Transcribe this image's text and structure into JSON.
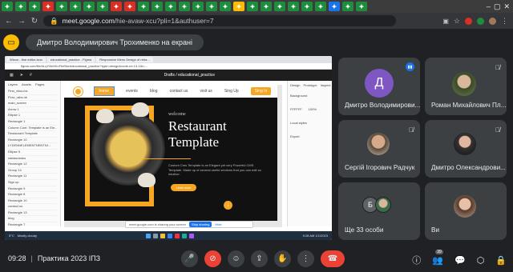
{
  "browser": {
    "url_host": "meet.google.com",
    "url_path": "/hie-avaw-xcu?pli=1&authuser=7",
    "tab_icons": [
      {
        "color": "#1e8e3e",
        "glyph": "✦"
      },
      {
        "color": "#1e8e3e",
        "glyph": "✦"
      },
      {
        "color": "#1e8e3e",
        "glyph": "✦"
      },
      {
        "color": "#d93025",
        "glyph": "✦"
      },
      {
        "color": "#1e8e3e",
        "glyph": "✦"
      },
      {
        "color": "#1e8e3e",
        "glyph": "✦"
      },
      {
        "color": "#1e8e3e",
        "glyph": "✦"
      },
      {
        "color": "#1e8e3e",
        "glyph": "✦"
      },
      {
        "color": "#d93025",
        "glyph": "✦"
      },
      {
        "color": "#d93025",
        "glyph": "✦"
      },
      {
        "color": "#1e8e3e",
        "glyph": "✦"
      },
      {
        "color": "#1e8e3e",
        "glyph": "✦"
      },
      {
        "color": "#1e8e3e",
        "glyph": "✦"
      },
      {
        "color": "#1e8e3e",
        "glyph": "✦"
      },
      {
        "color": "#1e8e3e",
        "glyph": "✦"
      },
      {
        "color": "#1e8e3e",
        "glyph": "✦"
      },
      {
        "color": "#1e8e3e",
        "glyph": "✦"
      },
      {
        "color": "#fbbc04",
        "glyph": "✦"
      },
      {
        "color": "#1e8e3e",
        "glyph": "✦"
      },
      {
        "color": "#1e8e3e",
        "glyph": "✦"
      },
      {
        "color": "#1e8e3e",
        "glyph": "✦"
      },
      {
        "color": "#1e8e3e",
        "glyph": "✦"
      },
      {
        "color": "#1e8e3e",
        "glyph": "✦"
      },
      {
        "color": "#1e8e3e",
        "glyph": "✦"
      },
      {
        "color": "#1a73e8",
        "glyph": "✦"
      },
      {
        "color": "#1e8e3e",
        "glyph": "✦"
      },
      {
        "color": "#1e8e3e",
        "glyph": "✦"
      }
    ]
  },
  "banner": {
    "presenting_text": "Дмитро Володимирович Трохименко на екрані"
  },
  "shared_screen": {
    "tabs": [
      "Wixon - fine editor-ixon",
      "educational_practice - Figma",
      "Responsive Menu Design of reha...",
      ""
    ],
    "url": "figma.com/file/hLqY0kMXoFfnf5kx/educational_practice?type=design&node-id=13-1&t=...",
    "top_bar": {
      "left": "Drafts",
      "project": "educational_practice"
    },
    "left_panel": {
      "tabs": [
        "Layers",
        "Assets",
        "Pages"
      ],
      "rows": [
        "First_vkus.ink",
        "Flow_rabs.nk",
        "main_screen",
        "Arrow 1",
        "Ellipse 1",
        "Rectangle 1",
        "Column Cont. Template is an Ele...",
        "Restaurant Template",
        "Rectangle 10",
        "LYDENNELEMENTNENTNI...",
        "Ellipse 5",
        "rastaurantus",
        "Rectangle 12",
        "Group 14",
        "Rectangle 11",
        "Sign up",
        "Rectangle 9",
        "Rectangle 8",
        "Rectangle 10",
        "contact us",
        "Rectangle 13",
        "blog",
        "Rectangle 7"
      ]
    },
    "right_panel": {
      "tabs": [
        "Design",
        "Prototype",
        "Inspect"
      ],
      "rows": [
        "Background",
        "FFFFFF",
        "100%",
        "Local styles",
        "Export"
      ]
    },
    "site": {
      "nav": [
        "home",
        "events",
        "blog",
        "contact us",
        "visit us",
        "Sing Up",
        "Sing In"
      ],
      "welcome": "welcome",
      "title_line1": "Restaurant",
      "title_line2": "Template",
      "description": "Custom Cms Template is an Elegant yet very Powerful CMS Template. Made up of several useful sections that you can edit so intuitive.",
      "button": "Learn more"
    },
    "share_bar": {
      "text": "meet.google.com is sharing your screen",
      "stop": "Stop sharing",
      "hide": "Hide"
    },
    "taskbar": {
      "weather_temp": "5°C",
      "weather_desc": "Mostly cloudy",
      "time": "9:28 AM",
      "date": "1/1/2023"
    }
  },
  "participants": [
    {
      "name": "Дмитро Володимирови...",
      "initial": "Д",
      "avatar_color": "#7e57c2",
      "speaking": true
    },
    {
      "name": "Роман Михайлович Пл...",
      "muted": true
    },
    {
      "name": "Сергій Ігорович Радчук",
      "muted": true
    },
    {
      "name": "Дмитро Олександрови...",
      "muted": true
    },
    {
      "name": "Ще 33 особи",
      "initial": "Б",
      "avatar_color": "#5f6368"
    },
    {
      "name": "Ви"
    }
  ],
  "meeting": {
    "time": "09:28",
    "separator": "|",
    "title": "Практика 2023 ІПЗ",
    "participants_count": "39"
  },
  "colors": {
    "end_call": "#ea4335",
    "accent": "#f5a623",
    "speaking": "#1a73e8"
  }
}
